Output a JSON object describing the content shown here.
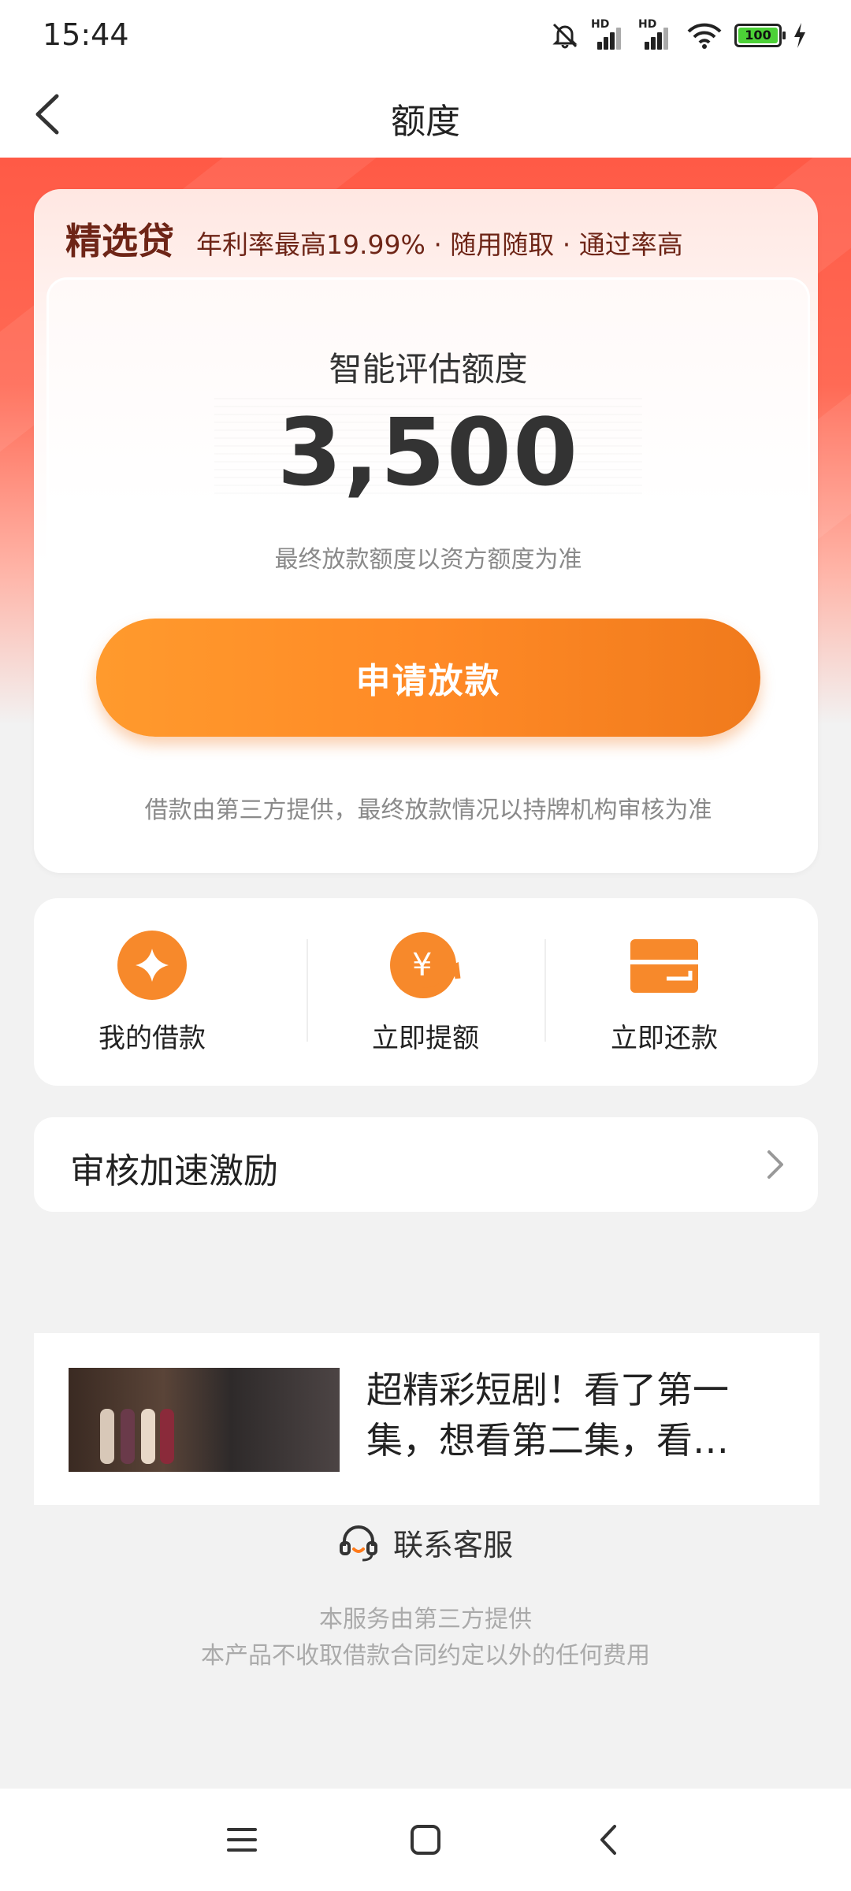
{
  "status_bar": {
    "time": "15:44",
    "hd1": "HD",
    "hd2": "HD",
    "battery": "100"
  },
  "nav": {
    "title": "额度"
  },
  "card": {
    "brand": "精选贷",
    "tags": "年利率最高19.99% · 随用随取 · 通过率高",
    "eval_label": "智能评估额度",
    "amount": "3,500",
    "note": "最终放款额度以资方额度为准",
    "apply_button": "申请放款",
    "disclaimer": "借款由第三方提供，最终放款情况以持牌机构审核为准"
  },
  "quick_actions": [
    {
      "label": "我的借款",
      "icon": "diamond-circle-icon"
    },
    {
      "label": "立即提额",
      "icon": "yuan-up-icon"
    },
    {
      "label": "立即还款",
      "icon": "card-icon"
    }
  ],
  "review_boost": {
    "label": "审核加速激励"
  },
  "ad": {
    "title": "超精彩短剧！看了第一集，想看第二集，看…"
  },
  "customer_service": {
    "label": "联系客服"
  },
  "footer": {
    "line1": "本服务由第三方提供",
    "line2": "本产品不收取借款合同约定以外的任何费用"
  },
  "colors": {
    "accent": "#ff8a26",
    "brand": "#6e2517",
    "hero": "#ff5a46"
  }
}
